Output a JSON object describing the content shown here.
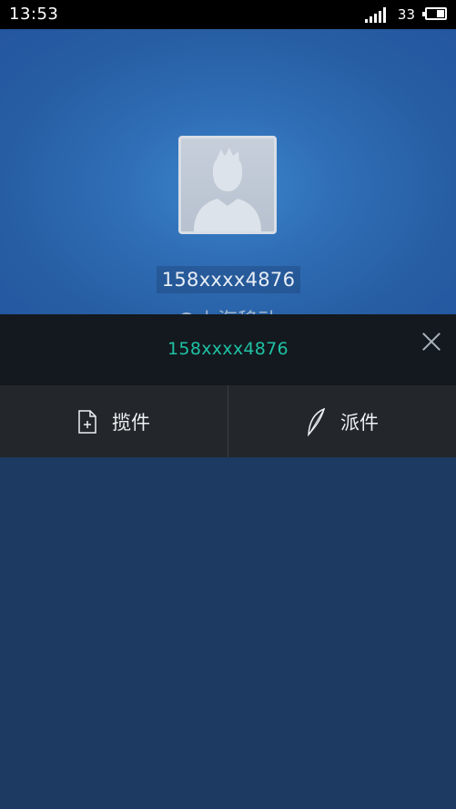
{
  "status_bar": {
    "time": "13:53",
    "battery_level": "33"
  },
  "header": {
    "name": "158xxxx4876",
    "carrier": "上海移动"
  },
  "number_bar": {
    "number": "158xxxx4876"
  },
  "actions": [
    {
      "label": "揽件",
      "icon": "document-plus-icon"
    },
    {
      "label": "派件",
      "icon": "feather-icon"
    }
  ],
  "colors": {
    "accent": "#1fc1a4",
    "header_bg": "#2f6db5",
    "bar_bg": "#13191e",
    "actions_bg": "#23272b"
  }
}
